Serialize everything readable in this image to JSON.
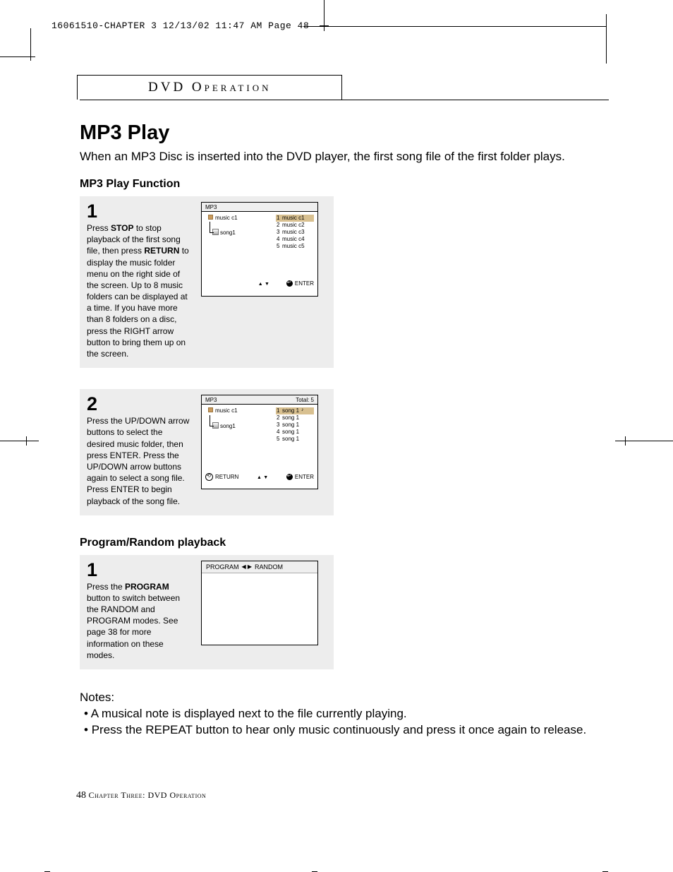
{
  "print_header": "16061510-CHAPTER 3  12/13/02 11:47 AM  Page 48",
  "section_title": "DVD Operation",
  "heading_main": "MP3 Play",
  "intro_text": "When an MP3 Disc is inserted into the DVD player, the first song file of the first folder plays.",
  "subheading_play_function": "MP3 Play Function",
  "step1": {
    "num": "1",
    "text_parts": {
      "p1": "Press ",
      "b1": "STOP",
      "p2": " to stop playback of the first song file, then press ",
      "b2": "RETURN",
      "p3": " to display the music folder menu on the right side of the screen. Up to 8 music folders can be displayed at a time. If you have more than 8 folders on a disc, press the RIGHT arrow button to bring them up on the screen."
    },
    "screen": {
      "title": "MP3",
      "tree_folder": "music c1",
      "tree_song": "song1",
      "list": [
        {
          "n": "1",
          "t": "music c1",
          "sel": true
        },
        {
          "n": "2",
          "t": "music c2"
        },
        {
          "n": "3",
          "t": "music c3"
        },
        {
          "n": "4",
          "t": "music c4"
        },
        {
          "n": "5",
          "t": "music c5"
        }
      ],
      "footer_enter": "ENTER"
    }
  },
  "step2": {
    "num": "2",
    "text": "Press the UP/DOWN arrow buttons to select the desired music folder, then press ENTER. Press the UP/DOWN arrow buttons again to select a song file. Press ENTER to begin playback of the song file.",
    "screen": {
      "title": "MP3",
      "title_right": "Total: 5",
      "tree_folder": "music c1",
      "tree_song": "song1",
      "list": [
        {
          "n": "1",
          "t": "song 1",
          "sel": true,
          "note": true
        },
        {
          "n": "2",
          "t": "song 1"
        },
        {
          "n": "3",
          "t": "song 1"
        },
        {
          "n": "4",
          "t": "song 1"
        },
        {
          "n": "5",
          "t": "song 1"
        }
      ],
      "footer_return": "RETURN",
      "footer_enter": "ENTER"
    }
  },
  "subheading_program": "Program/Random playback",
  "step3": {
    "num": "1",
    "text_parts": {
      "p1": "Press the ",
      "b1": "PROGRAM",
      "p2": " button to switch between the RANDOM and PROGRAM modes. See page 38 for more information on these modes."
    },
    "screen": {
      "left": "PROGRAM",
      "right": "RANDOM"
    }
  },
  "notes_heading": "Notes:",
  "notes": [
    "A musical note is displayed next to the file currently playing.",
    "Press the REPEAT button to hear only music continuously and press it once again to release."
  ],
  "page_number": "48",
  "footer_chapter": "Chapter Three: DVD Operation"
}
